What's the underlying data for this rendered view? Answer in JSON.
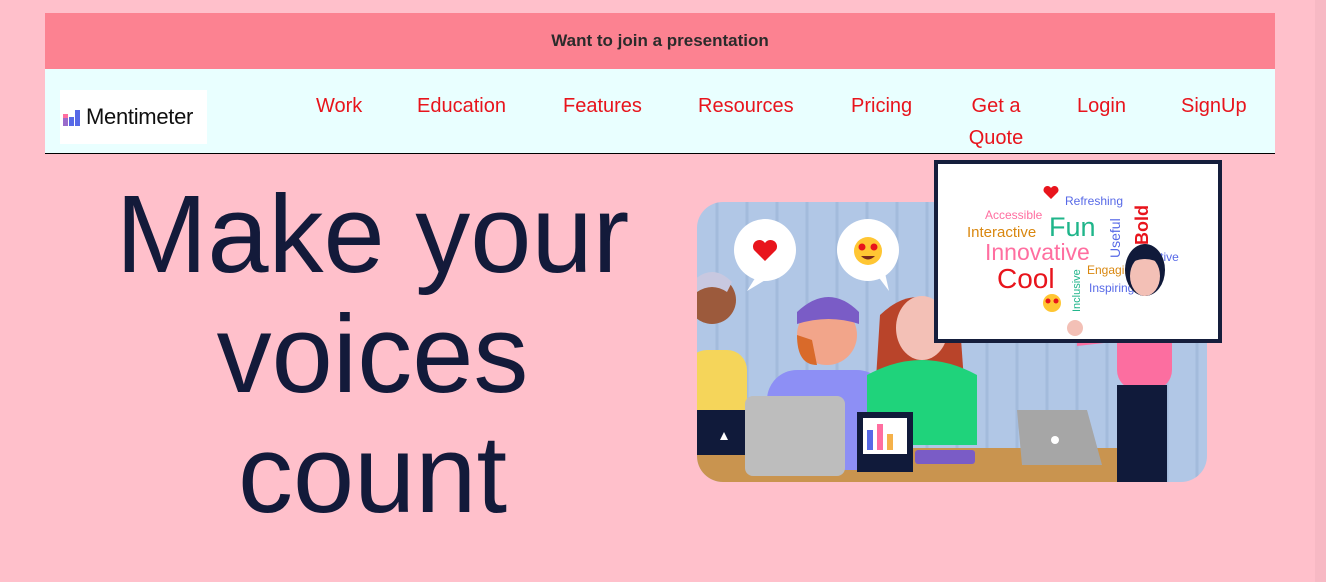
{
  "banner": {
    "text": "Want to join a presentation"
  },
  "brand": {
    "name": "Mentimeter",
    "logo_icon": "mentimeter-bars-icon"
  },
  "nav": {
    "items": [
      {
        "label": "Work"
      },
      {
        "label": "Education"
      },
      {
        "label": "Features"
      },
      {
        "label": "Resources"
      },
      {
        "label": "Pricing"
      },
      {
        "label_line1": "Get a",
        "label_line2": "Quote"
      },
      {
        "label": "Login"
      },
      {
        "label": "SignUp"
      }
    ]
  },
  "hero": {
    "line1": "Make your",
    "line2": "voices",
    "line3": "count"
  },
  "illustration": {
    "word_cloud": {
      "words": [
        "Refreshing",
        "Accessible",
        "Fun",
        "Bold",
        "Interactive",
        "Useful",
        "Innovative",
        "Effective",
        "Cool",
        "Engaging",
        "Inclusive",
        "Inspiring"
      ]
    }
  },
  "colors": {
    "page_bg": "#ffc0cb",
    "banner_bg": "#fc8291",
    "nav_bg": "#e9ffff",
    "nav_link": "#e8141c",
    "hero_text": "#131a3a"
  }
}
